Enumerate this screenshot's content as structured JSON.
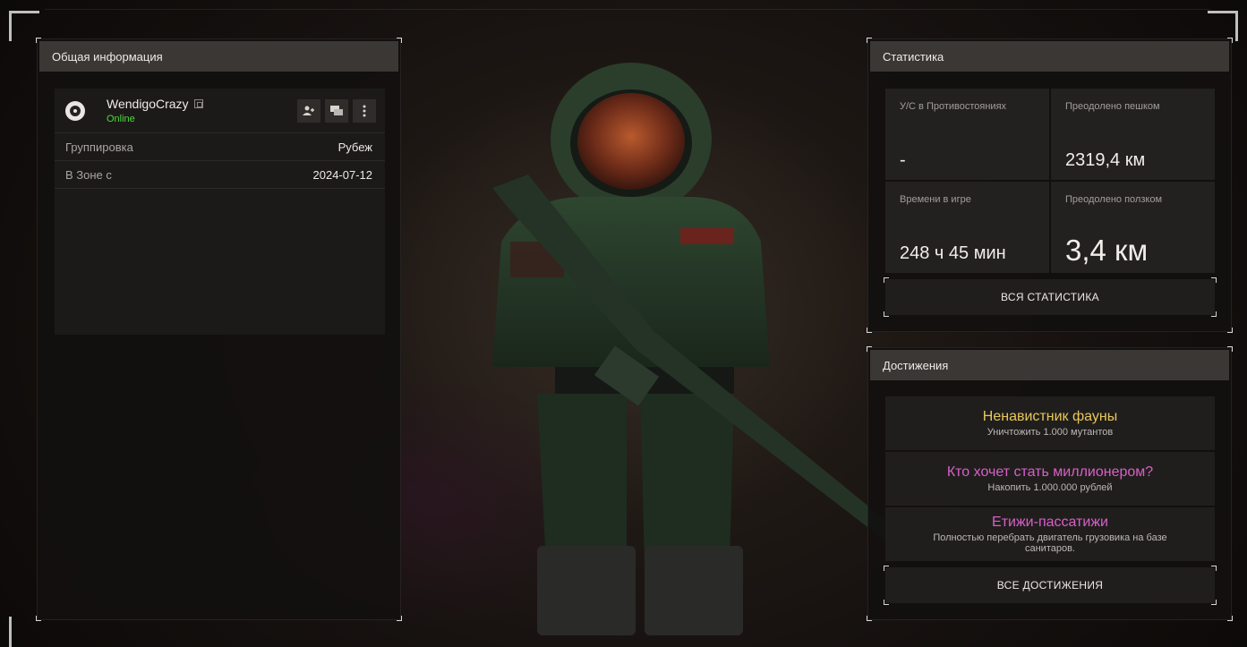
{
  "general": {
    "header": "Общая информация",
    "profile": {
      "username": "WendigoCrazy",
      "status": "Online",
      "status_color": "#4fd83a",
      "actions": [
        "add-friend-icon",
        "message-icon",
        "more-icon"
      ]
    },
    "rows": [
      {
        "label": "Группировка",
        "value": "Рубеж"
      },
      {
        "label": "В Зоне с",
        "value": "2024-07-12"
      }
    ]
  },
  "stats": {
    "header": "Статистика",
    "cells": [
      {
        "label": "У/С в Противостояниях",
        "value": "-"
      },
      {
        "label": "Преодолено пешком",
        "value": "2319,4 км"
      },
      {
        "label": "Времени в игре",
        "value": "248 ч 45 мин"
      },
      {
        "label": "Преодолено ползком",
        "value": "3,4 км"
      }
    ],
    "all_button": "ВСЯ СТАТИСТИКА"
  },
  "achievements": {
    "header": "Достижения",
    "items": [
      {
        "title": "Ненавистник фауны",
        "desc": "Уничтожить 1.000 мутантов",
        "color": "#e8c75a"
      },
      {
        "title": "Кто хочет стать миллионером?",
        "desc": "Накопить 1.000.000 рублей",
        "color": "#d95fc9"
      },
      {
        "title": "Етижи-пассатижи",
        "desc": "Полностью перебрать двигатель грузовика на базе санитаров.",
        "color": "#d95fc9"
      }
    ],
    "all_button": "ВСЕ ДОСТИЖЕНИЯ"
  }
}
